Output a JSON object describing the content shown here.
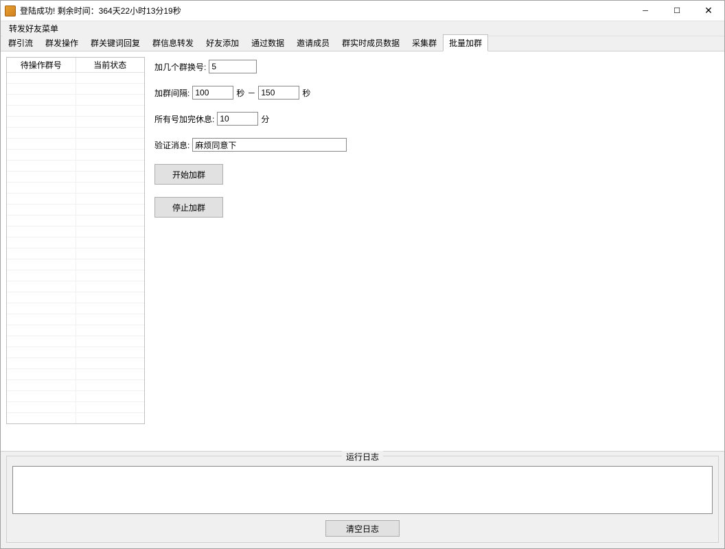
{
  "window": {
    "title": "登陆成功! 剩余时间：364天22小时13分19秒"
  },
  "menu": {
    "item1": "转发好友菜单"
  },
  "tabs": [
    "群引流",
    "群发操作",
    "群关键词回复",
    "群信息转发",
    "好友添加",
    "通过数据",
    "邀请成员",
    "群实时成员数据",
    "采集群",
    "批量加群"
  ],
  "table": {
    "col1": "待操作群号",
    "col2": "当前状态"
  },
  "form": {
    "switch_label": "加几个群换号:",
    "switch_val": "5",
    "interval_label": "加群间隔:",
    "interval_min": "100",
    "interval_max": "150",
    "sec": "秒",
    "dash": "－",
    "rest_label": "所有号加完休息:",
    "rest_val": "10",
    "min": "分",
    "verify_label": "验证消息:",
    "verify_val": "麻烦同意下",
    "start_btn": "开始加群",
    "stop_btn": "停止加群"
  },
  "log": {
    "legend": "运行日志",
    "clear_btn": "清空日志"
  }
}
